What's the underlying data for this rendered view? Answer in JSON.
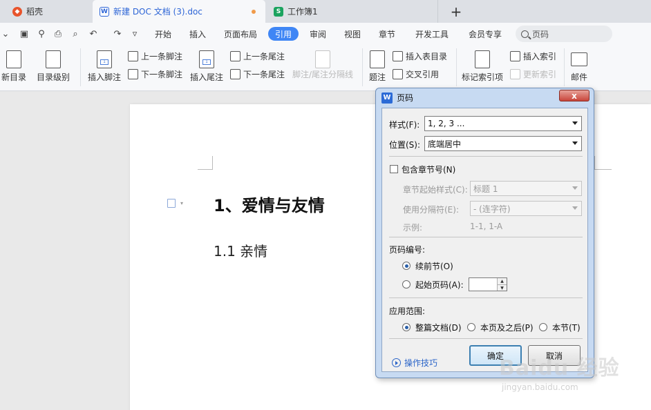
{
  "tabs": {
    "docer": "稻壳",
    "document": "新建 DOC 文档 (3).doc",
    "workbook": "工作簿1",
    "add": "+"
  },
  "menu": {
    "items": [
      "开始",
      "插入",
      "页面布局",
      "引用",
      "审阅",
      "视图",
      "章节",
      "开发工具",
      "会员专享"
    ],
    "active": "引用",
    "search_placeholder": "页码"
  },
  "ribbon": {
    "update_toc": "新目录",
    "toc_level": "目录级别",
    "insert_footnote": "插入脚注",
    "prev_footnote": "上一条脚注",
    "next_footnote": "下一条脚注",
    "insert_endnote": "插入尾注",
    "prev_endnote": "上一条尾注",
    "next_endnote": "下一条尾注",
    "note_separator": "脚注/尾注分隔线",
    "caption": "题注",
    "insert_figure_table": "插入表目录",
    "cross_reference": "交叉引用",
    "mark_index": "标记索引项",
    "insert_index": "插入索引",
    "update_index": "更新索引",
    "mail": "邮件"
  },
  "document": {
    "heading1": "1、爱情与友情",
    "heading2": "1.1 亲情"
  },
  "dialog": {
    "title": "页码",
    "close": "x",
    "style_label": "样式(F):",
    "style_value": "1, 2, 3 ...",
    "position_label": "位置(S):",
    "position_value": "底端居中",
    "include_chapter": "包含章节号(N)",
    "chapter_style_label": "章节起始样式(C):",
    "chapter_style_value": "标题 1",
    "separator_label": "使用分隔符(E):",
    "separator_value": "-    (连字符)",
    "example_label": "示例:",
    "example_value": "1-1, 1-A",
    "numbering_label": "页码编号:",
    "continue_prev": "续前节(O)",
    "start_at": "起始页码(A):",
    "scope_label": "应用范围:",
    "scope_whole": "整篇文档(D)",
    "scope_after": "本页及之后(P)",
    "scope_section": "本节(T)",
    "tips": "操作技巧",
    "ok": "确定",
    "cancel": "取消"
  },
  "watermark": {
    "brand": "Baidu 经验",
    "url": "jingyan.baidu.com"
  }
}
